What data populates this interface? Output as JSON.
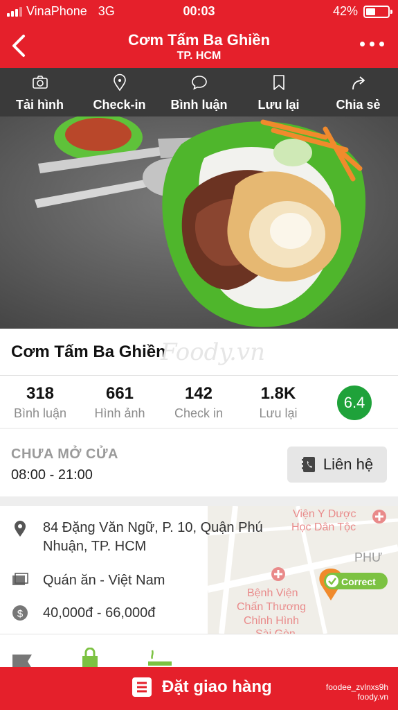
{
  "status_bar": {
    "carrier": "VinaPhone",
    "network": "3G",
    "time": "00:03",
    "battery": "42%",
    "battery_level": 0.42
  },
  "header": {
    "title": "Cơm Tấm Ba Ghiền",
    "subtitle": "TP. HCM"
  },
  "actions": [
    {
      "label": "Tải hình",
      "icon": "camera-icon"
    },
    {
      "label": "Check-in",
      "icon": "location-pin-icon"
    },
    {
      "label": "Bình luận",
      "icon": "speech-bubble-icon"
    },
    {
      "label": "Lưu lại",
      "icon": "bookmark-icon"
    },
    {
      "label": "Chia sẻ",
      "icon": "share-icon"
    }
  ],
  "restaurant": {
    "name": "Cơm Tấm Ba Ghiền",
    "watermark": "Foody.vn"
  },
  "stats": [
    {
      "value": "318",
      "label": "Bình luận"
    },
    {
      "value": "661",
      "label": "Hình ảnh"
    },
    {
      "value": "142",
      "label": "Check in"
    },
    {
      "value": "1.8K",
      "label": "Lưu lại"
    }
  ],
  "score": "6.4",
  "hours": {
    "status": "CHƯA MỞ CỬA",
    "time": "08:00 - 21:00",
    "contact_label": "Liên hệ"
  },
  "info": {
    "address_line1": "84 Đặng Văn Ngữ, P. 10, Quận Phú",
    "address_line2": "Nhuận, TP. HCM",
    "category": "Quán ăn - Việt Nam",
    "price": "40,000đ - 66,000đ"
  },
  "map": {
    "label_1a": "Viện Y Dược",
    "label_1b": "Học Dân Tộc",
    "label_2": "PHƯ",
    "label_3a": "Bệnh Viện",
    "label_3b": "Chấn Thương",
    "label_3c": "Chỉnh Hình",
    "label_3d": "Sài Gòn",
    "badge": "Correct"
  },
  "order": {
    "label": "Đặt giao hàng",
    "username": "foodee_zvlnxs9h",
    "brand": "foody.vn"
  },
  "colors": {
    "brand_red": "#e5202b",
    "toolbar": "#3a3a3a",
    "score_green": "#1fa23a"
  }
}
